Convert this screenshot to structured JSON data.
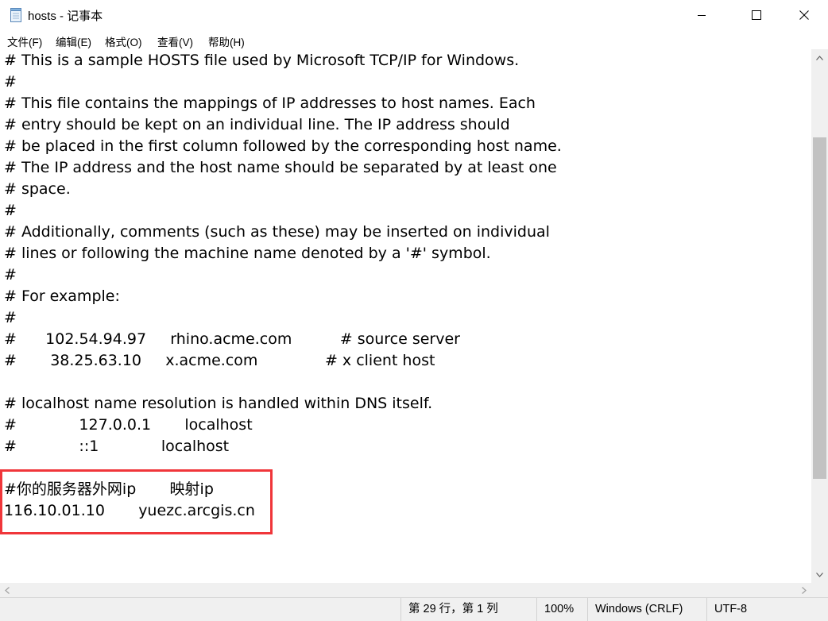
{
  "window": {
    "title": "hosts - 记事本"
  },
  "menu": {
    "items": [
      "文件(F)",
      "编辑(E)",
      "格式(O)",
      "查看(V)",
      "帮助(H)"
    ]
  },
  "editor": {
    "lines": [
      "# This is a sample HOSTS file used by Microsoft TCP/IP for Windows.",
      "#",
      "# This file contains the mappings of IP addresses to host names. Each",
      "# entry should be kept on an individual line. The IP address should",
      "# be placed in the first column followed by the corresponding host name.",
      "# The IP address and the host name should be separated by at least one",
      "# space.",
      "#",
      "# Additionally, comments (such as these) may be inserted on individual",
      "# lines or following the machine name denoted by a '#' symbol.",
      "#",
      "# For example:",
      "#",
      "#      102.54.94.97     rhino.acme.com          # source server",
      "#       38.25.63.10     x.acme.com              # x client host",
      "",
      "# localhost name resolution is handled within DNS itself.",
      "#             127.0.0.1       localhost",
      "#             ::1             localhost",
      "",
      "#你的服务器外网ip       映射ip",
      "116.10.01.10       yuezc.arcgis.cn"
    ]
  },
  "status": {
    "position": "第 29 行，第 1 列",
    "zoom": "100%",
    "line_ending": "Windows (CRLF)",
    "encoding": "UTF-8"
  },
  "colors": {
    "highlight_border": "#f0363a",
    "scrollbar_thumb": "#c2c2c2"
  }
}
